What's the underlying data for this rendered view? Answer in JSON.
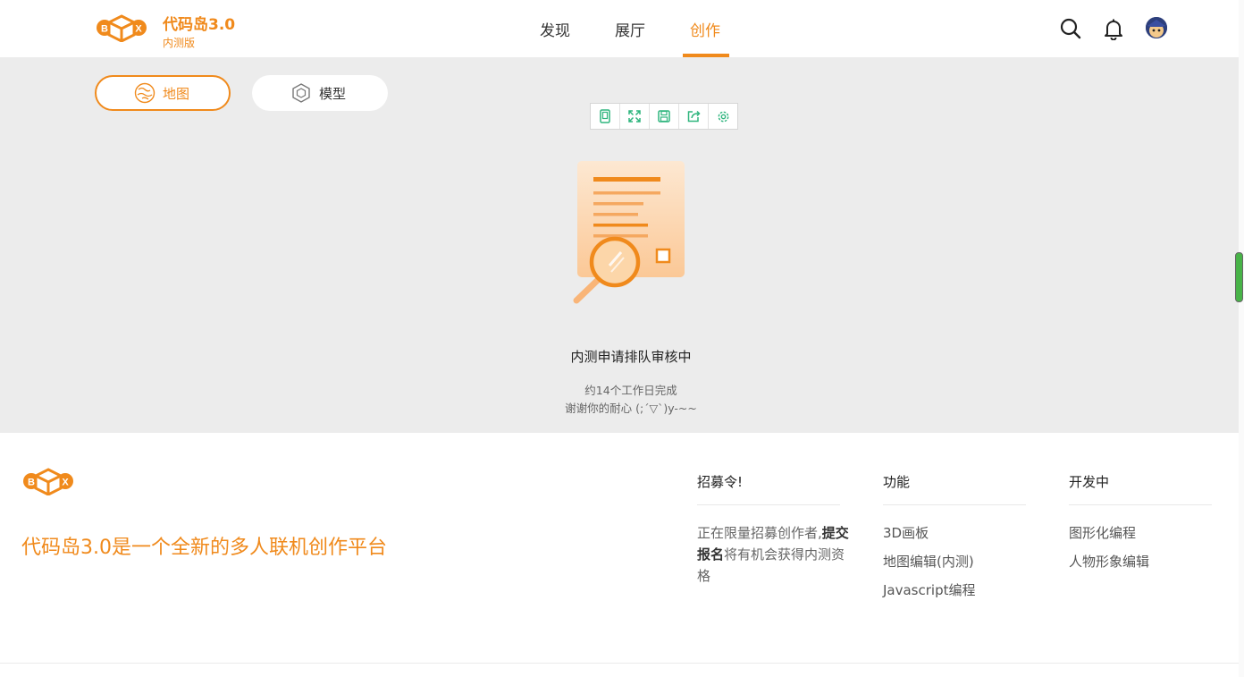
{
  "header": {
    "brand_title": "代码岛3.0",
    "brand_subtitle": "内测版",
    "logo_letters": [
      "B",
      "X"
    ],
    "nav": [
      {
        "label": "发现",
        "active": false
      },
      {
        "label": "展厅",
        "active": false
      },
      {
        "label": "创作",
        "active": true
      }
    ],
    "icons": [
      "search-icon",
      "bell-icon",
      "avatar"
    ]
  },
  "tabs": [
    {
      "label": "地图",
      "icon": "map-icon",
      "active": true
    },
    {
      "label": "模型",
      "icon": "cube-icon",
      "active": false
    }
  ],
  "toolbar": [
    "mobile-icon",
    "fullscreen-icon",
    "save-icon",
    "share-icon",
    "settings-icon"
  ],
  "status": {
    "title": "内测申请排队审核中",
    "line1": "约14个工作日完成",
    "line2": "谢谢你的耐心 (;´▽`)y-~~"
  },
  "footer": {
    "slogan": "代码岛3.0是一个全新的多人联机创作平台",
    "columns": {
      "recruit": {
        "heading": "招募令!",
        "text_before": "正在限量招募创作者,",
        "text_bold": "提交报名",
        "text_after": "将有机会获得内测资格"
      },
      "features": {
        "heading": "功能",
        "links": [
          "3D画板",
          "地图编辑(内测)",
          "Javascript编程"
        ]
      },
      "developing": {
        "heading": "开发中",
        "links": [
          "图形化编程",
          "人物形象编辑"
        ]
      }
    }
  },
  "colors": {
    "accent": "#f08a1c",
    "tool_icon": "#2fb57e",
    "main_bg": "#ececec"
  }
}
